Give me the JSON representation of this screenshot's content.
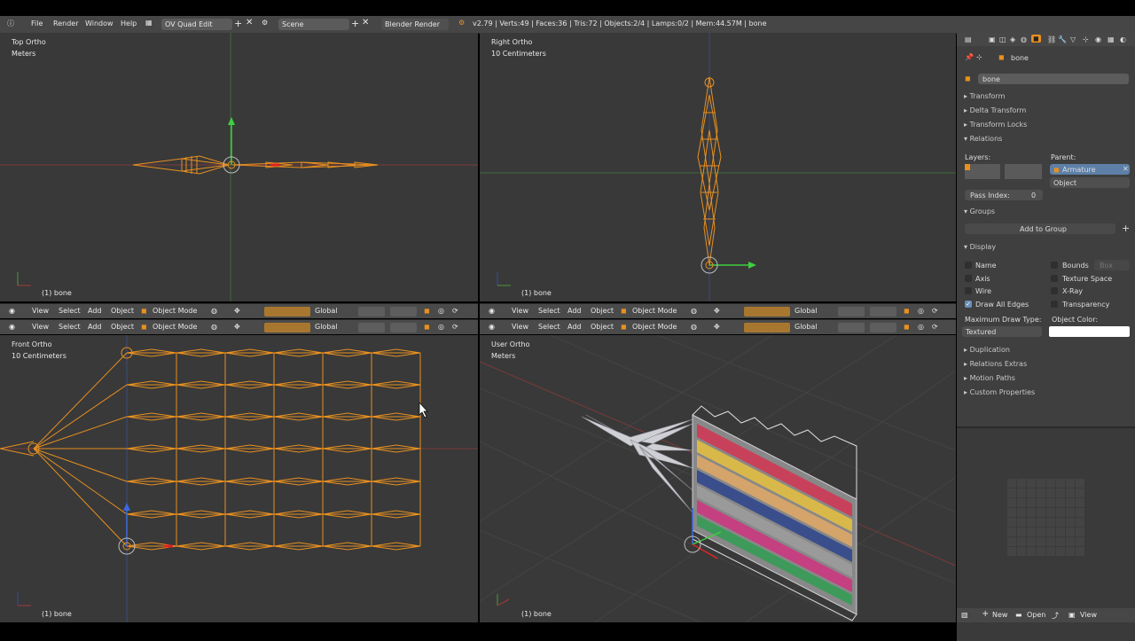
{
  "menu": {
    "items": [
      "File",
      "Render",
      "Window",
      "Help"
    ],
    "screen_layout": "OV Quad Edit",
    "scene": "Scene",
    "render_engine": "Blender Render",
    "status": "v2.79 | Verts:49 | Faces:36 | Tris:72 | Objects:2/4 | Lamps:0/2 | Mem:44.57M | bone"
  },
  "viewports": {
    "top_left": {
      "name": "Top Ortho",
      "units": "Meters",
      "selection": "(1) bone"
    },
    "top_right": {
      "name": "Right Ortho",
      "units": "10 Centimeters",
      "selection": "(1) bone"
    },
    "bottom_left": {
      "name": "Front Ortho",
      "units": "10 Centimeters",
      "selection": "(1) bone"
    },
    "bottom_right": {
      "name": "User Ortho",
      "units": "Meters",
      "selection": "(1) bone"
    }
  },
  "header": {
    "view": "View",
    "select": "Select",
    "add": "Add",
    "object": "Object",
    "mode": "Object Mode",
    "orientation": "Global"
  },
  "properties": {
    "object_name": "bone",
    "name_field": "bone",
    "panels": {
      "transform": "Transform",
      "delta_transform": "Delta Transform",
      "transform_locks": "Transform Locks",
      "relations": "Relations",
      "groups": "Groups",
      "display": "Display",
      "duplication": "Duplication",
      "relations_extras": "Relations Extras",
      "motion_paths": "Motion Paths",
      "custom_properties": "Custom Properties"
    },
    "relations": {
      "layers_label": "Layers:",
      "parent_label": "Parent:",
      "parent_value": "Armature",
      "parent_type": "Object",
      "pass_index_label": "Pass Index:",
      "pass_index_value": "0"
    },
    "groups": {
      "add_to_group": "Add to Group"
    },
    "display": {
      "name": "Name",
      "bounds": "Bounds",
      "bounds_type": "Box",
      "axis": "Axis",
      "texture_space": "Texture Space",
      "wire": "Wire",
      "xray": "X-Ray",
      "draw_all_edges": "Draw All Edges",
      "transparency": "Transparency",
      "max_draw_type_label": "Maximum Draw Type:",
      "max_draw_type_value": "Textured",
      "object_color_label": "Object Color:",
      "object_color": "#ffffff",
      "draw_all_edges_checked": true
    }
  },
  "image_editor": {
    "new": "New",
    "open": "Open",
    "view": "View"
  },
  "colors": {
    "bone_orange": "#e8901f",
    "axis_red": "#a33a3a",
    "axis_green": "#4a9a3a",
    "viewport_bg": "#393939"
  }
}
